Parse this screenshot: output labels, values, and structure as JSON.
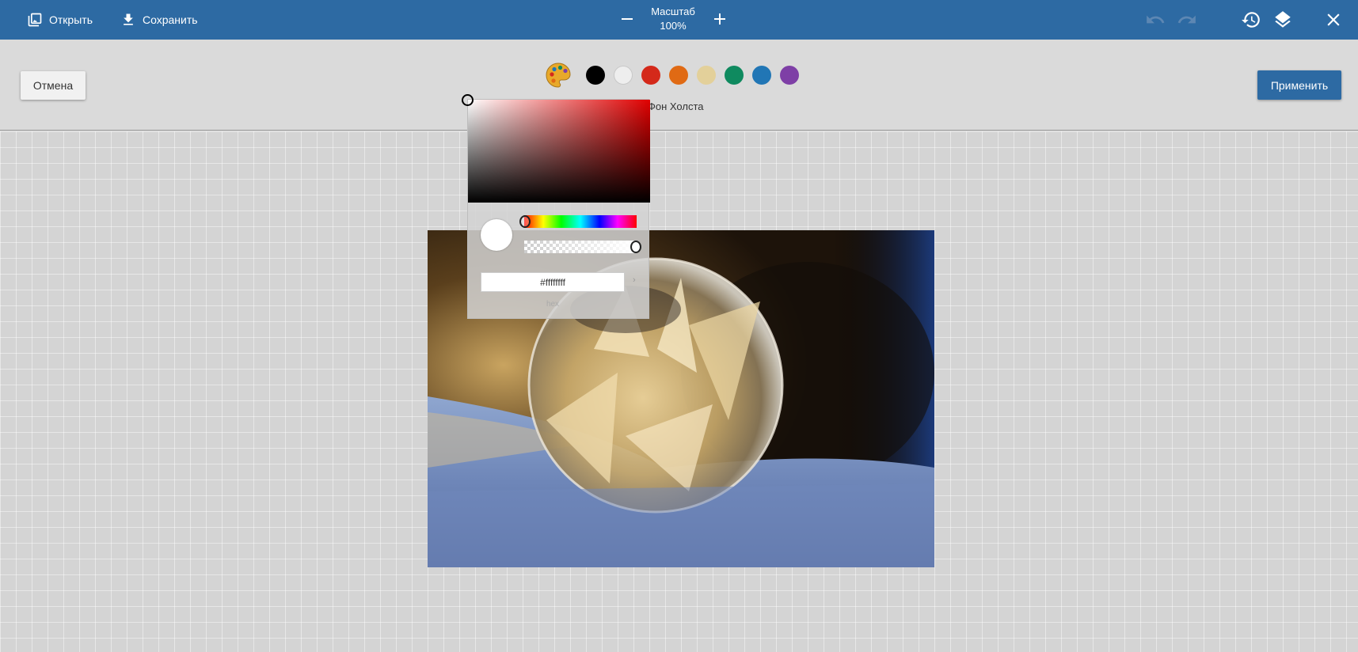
{
  "header": {
    "open_label": "Открыть",
    "save_label": "Сохранить",
    "zoom_title": "Масштаб",
    "zoom_value": "100%"
  },
  "toolbar": {
    "cancel_label": "Отмена",
    "apply_label": "Применить",
    "background_label": "Фон Холста",
    "swatches": [
      "#000000",
      "#eeeeee",
      "#d4291a",
      "#e06a14",
      "#e3d09a",
      "#0f8a5f",
      "#2176b5",
      "#7e3fa6"
    ]
  },
  "picker": {
    "hex_value": "#ffffffff",
    "hex_label": "hex",
    "preview_color": "#ffffff",
    "hue_color": "#e00000"
  },
  "icons": {
    "open": "image-icon",
    "save": "download-icon",
    "zoom_out": "minus-icon",
    "zoom_in": "plus-icon",
    "undo": "undo-icon",
    "redo": "redo-icon",
    "history": "history-icon",
    "layers": "layers-icon",
    "close": "close-icon",
    "palette": "palette-icon"
  }
}
